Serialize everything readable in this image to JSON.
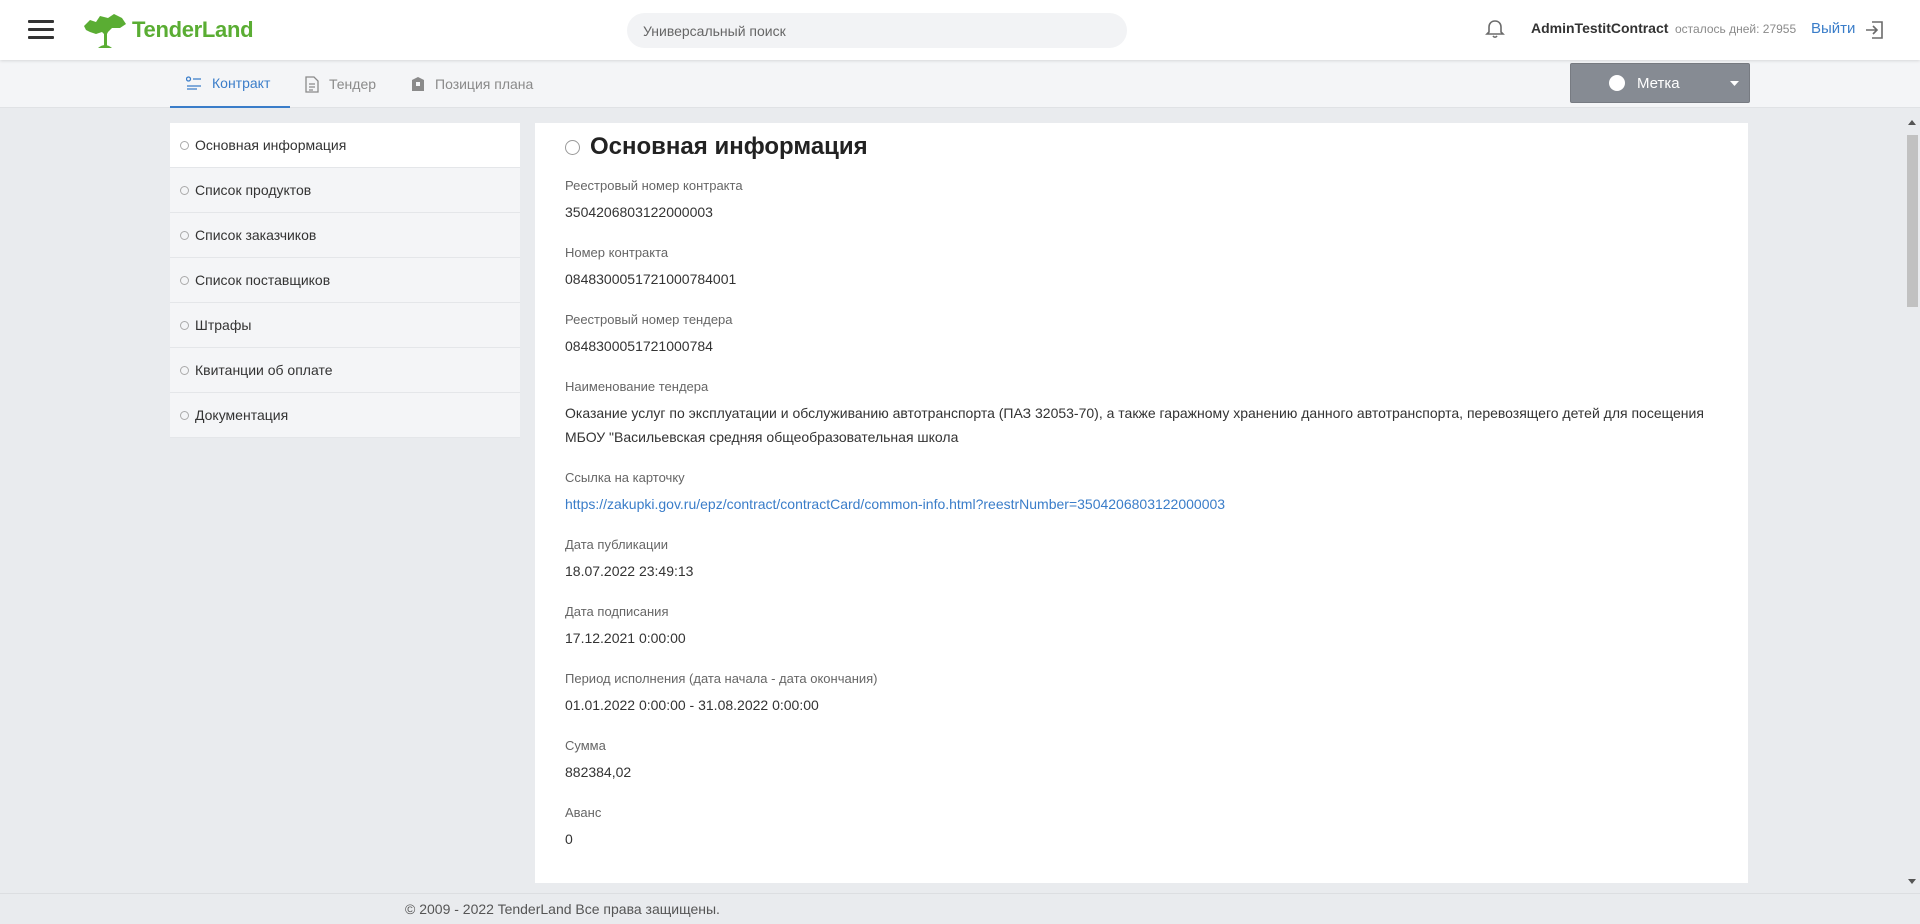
{
  "header": {
    "logo_text": "TenderLand",
    "search_placeholder": "Универсальный поиск",
    "user_name": "AdminTestitContract",
    "days_left": "осталось дней: 27955",
    "logout_label": "Выйти",
    "brand_color": "#5aad33",
    "accent_color": "#3a7dc9"
  },
  "tabs": [
    {
      "label": "Контракт",
      "icon": "contract-list-icon",
      "active": true
    },
    {
      "label": "Тендер",
      "icon": "document-icon",
      "active": false
    },
    {
      "label": "Позиция плана",
      "icon": "plan-icon",
      "active": false
    }
  ],
  "metka": {
    "label": "Метка"
  },
  "sidebar": {
    "items": [
      {
        "label": "Основная информация",
        "active": true
      },
      {
        "label": "Список продуктов"
      },
      {
        "label": "Список заказчиков"
      },
      {
        "label": "Список поставщиков"
      },
      {
        "label": "Штрафы"
      },
      {
        "label": "Квитанции об оплате"
      },
      {
        "label": "Документация"
      }
    ]
  },
  "main": {
    "title": "Основная информация",
    "fields": [
      {
        "label": "Реестровый номер контракта",
        "value": "3504206803122000003"
      },
      {
        "label": "Номер контракта",
        "value": "0848300051721000784001"
      },
      {
        "label": "Реестровый номер тендера",
        "value": "0848300051721000784"
      },
      {
        "label": "Наименование тендера",
        "value": "Оказание услуг по эксплуатации и обслуживанию автотранспорта (ПАЗ 32053-70), а также гаражному хранению данного автотранспорта, перевозящего детей для посещения МБОУ \"Васильевская средняя общеобразовательная школа"
      },
      {
        "label": "Ссылка на карточку",
        "value": "https://zakupki.gov.ru/epz/contract/contractCard/common-info.html?reestrNumber=3504206803122000003",
        "link": true
      },
      {
        "label": "Дата публикации",
        "value": "18.07.2022 23:49:13"
      },
      {
        "label": "Дата подписания",
        "value": "17.12.2021 0:00:00"
      },
      {
        "label": "Период исполнения (дата начала - дата окончания)",
        "value": "01.01.2022 0:00:00 - 31.08.2022 0:00:00"
      },
      {
        "label": "Сумма",
        "value": "882384,02"
      },
      {
        "label": "Аванс",
        "value": "0"
      }
    ]
  },
  "footer": {
    "text": "© 2009 - 2022 TenderLand Все права защищены."
  }
}
